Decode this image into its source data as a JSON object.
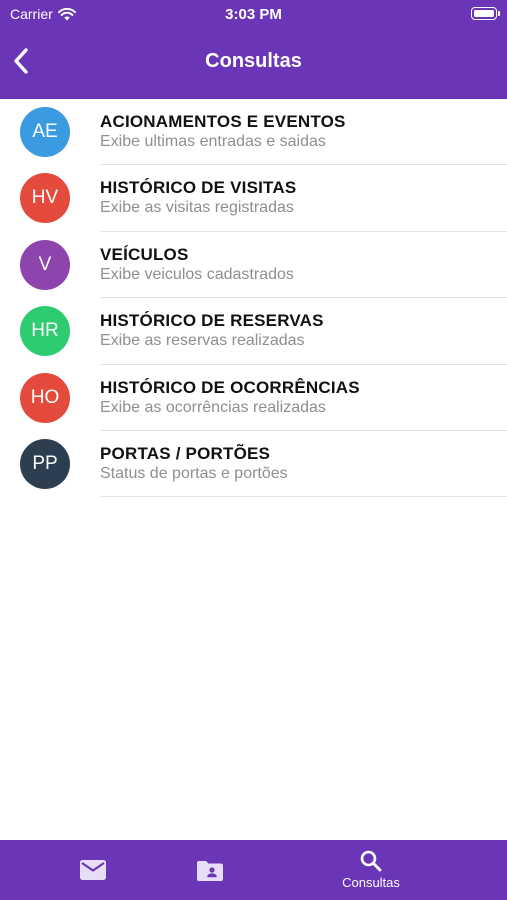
{
  "status_bar": {
    "carrier": "Carrier",
    "time": "3:03 PM"
  },
  "header": {
    "title": "Consultas"
  },
  "items": [
    {
      "initials": "AE",
      "title": "ACIONAMENTOS E EVENTOS",
      "subtitle": "Exibe ultimas entradas e saidas",
      "color": "#3b9be0"
    },
    {
      "initials": "HV",
      "title": "HISTÓRICO DE VISITAS",
      "subtitle": "Exibe as visitas registradas",
      "color": "#e54b3c"
    },
    {
      "initials": "V",
      "title": "VEÍCULOS",
      "subtitle": "Exibe veiculos cadastrados",
      "color": "#8e44ad"
    },
    {
      "initials": "HR",
      "title": "HISTÓRICO DE RESERVAS",
      "subtitle": "Exibe as reservas realizadas",
      "color": "#2ecc71"
    },
    {
      "initials": "HO",
      "title": "HISTÓRICO DE OCORRÊNCIAS",
      "subtitle": "Exibe as ocorrências realizadas",
      "color": "#e54b3c"
    },
    {
      "initials": "PP",
      "title": "PORTAS / PORTÕES",
      "subtitle": "Status de portas e portões",
      "color": "#2c3e50"
    }
  ],
  "tabbar": {
    "tabs": [
      {
        "icon": "mail-icon",
        "label": ""
      },
      {
        "icon": "contact-folder-icon",
        "label": ""
      },
      {
        "icon": "search-icon",
        "label": "Consultas"
      }
    ]
  },
  "colors": {
    "primary": "#6a35b7"
  }
}
